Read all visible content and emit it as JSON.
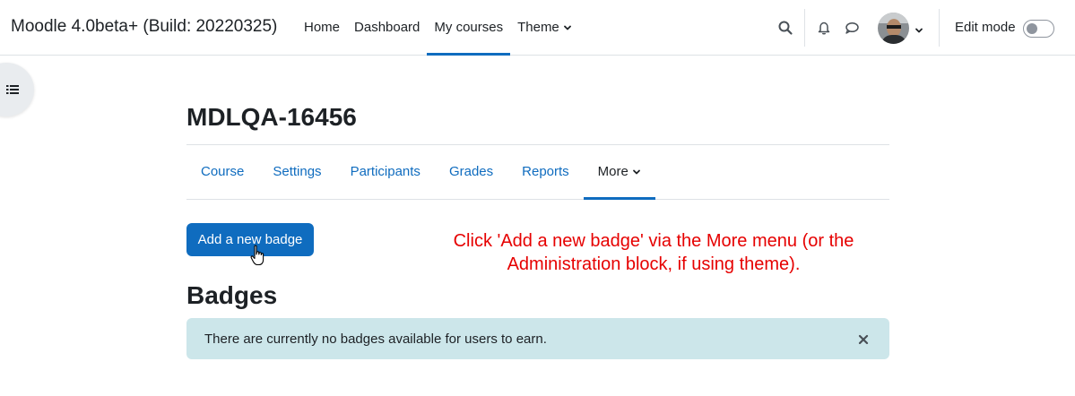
{
  "header": {
    "site_name": "Moodle 4.0beta+ (Build: 20220325)",
    "nav": [
      "Home",
      "Dashboard",
      "My courses",
      "Theme"
    ],
    "active_nav": "My courses",
    "edit_mode_label": "Edit mode",
    "edit_mode_on": false,
    "icons": [
      "search-icon",
      "bell-icon",
      "message-icon",
      "avatar",
      "chevron-down-icon"
    ]
  },
  "course": {
    "title": "MDLQA-16456",
    "tabs": [
      "Course",
      "Settings",
      "Participants",
      "Grades",
      "Reports",
      "More"
    ],
    "active_tab": "More"
  },
  "badges": {
    "add_button_label": "Add a new badge",
    "heading": "Badges",
    "empty_message": "There are currently no badges available for users to earn."
  },
  "annotation": {
    "text": "Click 'Add a new badge' via the More menu (or the Administration block, if using theme).",
    "color": "#e60000"
  },
  "colors": {
    "primary": "#0f6cbf",
    "alert_bg": "#cce6ea",
    "text": "#1d2125"
  }
}
